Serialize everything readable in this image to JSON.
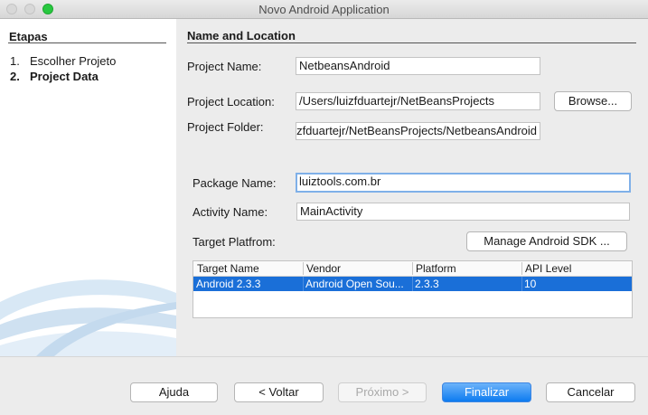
{
  "window": {
    "title": "Novo Android Application"
  },
  "steps": {
    "title": "Etapas",
    "items": [
      {
        "num": "1.",
        "label": "Escolher Projeto"
      },
      {
        "num": "2.",
        "label": "Project Data"
      }
    ]
  },
  "form": {
    "section_title": "Name and Location",
    "project_name_label": "Project Name:",
    "project_name_value": "NetbeansAndroid",
    "project_location_label": "Project Location:",
    "project_location_value": "/Users/luizfduartejr/NetBeansProjects",
    "browse_label": "Browse...",
    "project_folder_label": "Project Folder:",
    "project_folder_value": "/Users/luizfduartejr/NetBeansProjects/NetbeansAndroid",
    "package_name_label": "Package Name:",
    "package_name_value": "luiztools.com.br",
    "activity_name_label": "Activity Name:",
    "activity_name_value": "MainActivity",
    "target_platform_label": "Target Platfrom:",
    "manage_sdk_label": "Manage Android SDK ..."
  },
  "platform_table": {
    "columns": [
      "Target Name",
      "Vendor",
      "Platform",
      "API Level"
    ],
    "rows": [
      [
        "Android 2.3.3",
        "Android Open Sou...",
        "2.3.3",
        "10"
      ]
    ]
  },
  "footer": {
    "help_label": "Ajuda",
    "back_label": "< Voltar",
    "next_label": "Próximo >",
    "finish_label": "Finalizar",
    "cancel_label": "Cancelar"
  }
}
